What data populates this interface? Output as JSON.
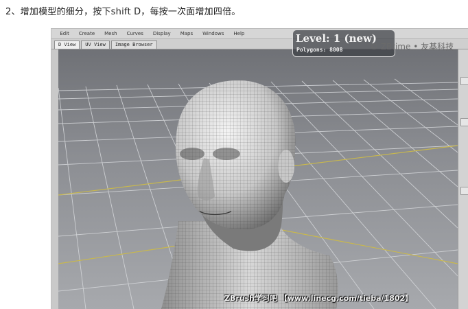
{
  "instruction": "2、增加模型的细分，按下shift D，每按一次面增加四倍。",
  "app": {
    "menu": [
      "e",
      "Edit",
      "Create",
      "Mesh",
      "Curves",
      "Display",
      "Maps",
      "Windows",
      "Help"
    ],
    "tabs": [
      "D View",
      "UV View",
      "Image Browser"
    ],
    "active_tab": "D View"
  },
  "hud": {
    "level": "Level: 1 (new)",
    "polygons": "Polygons: 8008"
  },
  "watermark": "© ZBtime • 友基科技",
  "caption": "ZBrush学习吧 【www.linecg.com/tieba/1802】"
}
